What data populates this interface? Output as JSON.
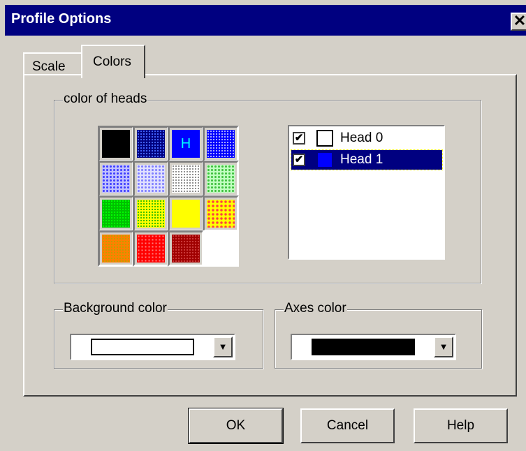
{
  "window": {
    "title": "Profile Options",
    "close_glyph": "✕"
  },
  "tabs": [
    {
      "label": "Scale",
      "active": false
    },
    {
      "label": "Colors",
      "active": true
    }
  ],
  "heads_group": {
    "legend": "color of heads",
    "palette_selected_letter": "H",
    "palette": [
      "black",
      "dotted-navy",
      "blue-selected",
      "dense-blue-dots",
      "light-blue-cross",
      "lavender-cross",
      "gray-cross",
      "light-green-cross",
      "green-dots",
      "yellow-green-cross",
      "yellow",
      "yellow-red-cross",
      "orange-dots",
      "red-dots",
      "maroon-dots",
      "white"
    ],
    "heads": [
      {
        "label": "Head 0",
        "checked": true,
        "check_glyph": "✔",
        "color": "#ffffff",
        "selected": false
      },
      {
        "label": "Head 1",
        "checked": true,
        "check_glyph": "✔",
        "color": "#0000ff",
        "selected": true
      }
    ]
  },
  "background_group": {
    "legend": "Background color",
    "value_color": "#ffffff",
    "arrow": "▼"
  },
  "axes_group": {
    "legend": "Axes color",
    "value_color": "#000000",
    "arrow": "▼"
  },
  "buttons": {
    "ok": "OK",
    "cancel": "Cancel",
    "help": "Help"
  }
}
